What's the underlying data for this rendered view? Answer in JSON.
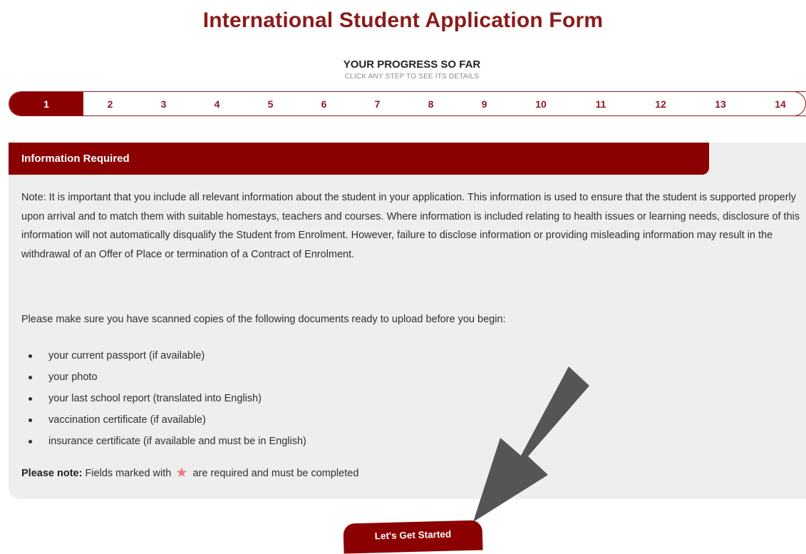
{
  "header": {
    "title": "International Student Application Form"
  },
  "progress": {
    "heading": "YOUR PROGRESS SO FAR",
    "subheading": "CLICK ANY STEP TO SEE ITS DETAILS",
    "steps": [
      "1",
      "2",
      "3",
      "4",
      "5",
      "6",
      "7",
      "8",
      "9",
      "10",
      "11",
      "12",
      "13",
      "14"
    ],
    "current_step": "1"
  },
  "info": {
    "title": "Information Required",
    "paragraph1": "Note: It is important that you include all relevant information about the student in your application. This information is used to ensure that the student is supported properly upon arrival and to match them with suitable homestays, teachers and courses. Where information is included relating to health issues or learning needs, disclosure of this information will not automatically disqualify the Student from Enrolment. However, failure to disclose information or providing misleading information may result in the withdrawal of an Offer of Place or termination of a Contract of Enrolment.",
    "paragraph2": "Please make sure you have scanned copies of the following documents ready to upload before you begin:",
    "documents": [
      "your current passport (if available)",
      "your photo",
      "your last school report (translated into English)",
      "vaccination certificate (if available)",
      "insurance certificate (if available and must be in English)"
    ],
    "note_label": "Please note:",
    "note_text_before": "Fields marked with",
    "note_text_after": "are required and must be completed"
  },
  "actions": {
    "start_label": "Let's Get Started"
  },
  "colors": {
    "brand": "#8b0000",
    "panel_background": "#eeeeee",
    "required_star": "#f07878",
    "arrow": "#555555"
  },
  "icons": {
    "required": "star-icon",
    "pointer": "arrow-icon"
  }
}
